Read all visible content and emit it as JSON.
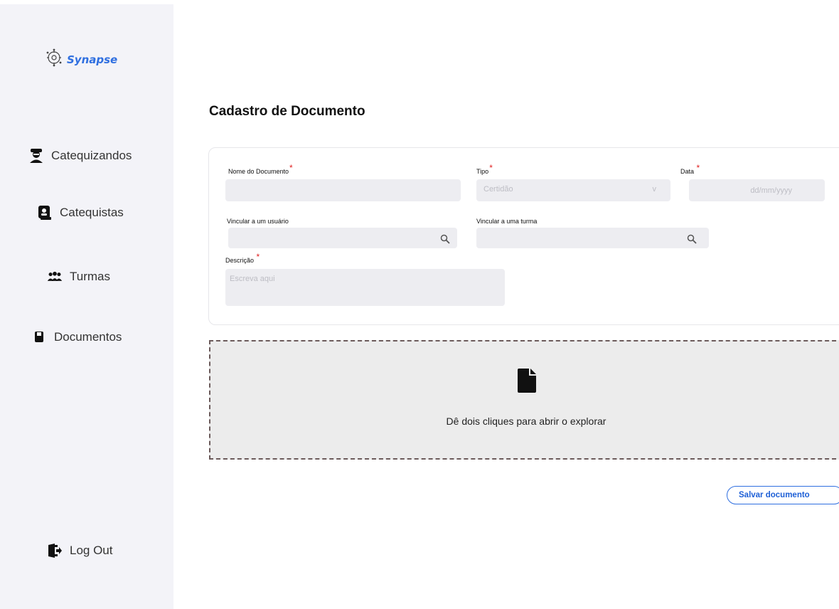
{
  "brand": {
    "name": "Synapse"
  },
  "nav": {
    "items": [
      {
        "label": "Catequizandos",
        "icon": "user-hat-icon"
      },
      {
        "label": "Catequistas",
        "icon": "id-badge-icon"
      },
      {
        "label": "Turmas",
        "icon": "group-icon"
      },
      {
        "label": "Documentos",
        "icon": "document-icon"
      }
    ],
    "logout": {
      "label": "Log Out",
      "icon": "logout-icon"
    }
  },
  "page": {
    "title": "Cadastro de Documento"
  },
  "form": {
    "nome": {
      "label": "Nome do Documento",
      "value": ""
    },
    "tipo": {
      "label": "Tipo",
      "value": "Certidão",
      "arrow": "v"
    },
    "data": {
      "label": "Data",
      "placeholder": "dd/mm/yyyy"
    },
    "usuario": {
      "label": "Vincular a um usuário"
    },
    "turma": {
      "label": "Vincular a uma turma"
    },
    "descricao": {
      "label": "Descrição",
      "placeholder": "Escreva aqui"
    },
    "required_mark": "*"
  },
  "dropzone": {
    "text": "Dê dois cliques para abrir o explorar"
  },
  "actions": {
    "save_label": "Salvar documento"
  },
  "colors": {
    "accent": "#2f6fe0",
    "required": "#e02020",
    "sidebar_bg": "#f3f3f8"
  }
}
